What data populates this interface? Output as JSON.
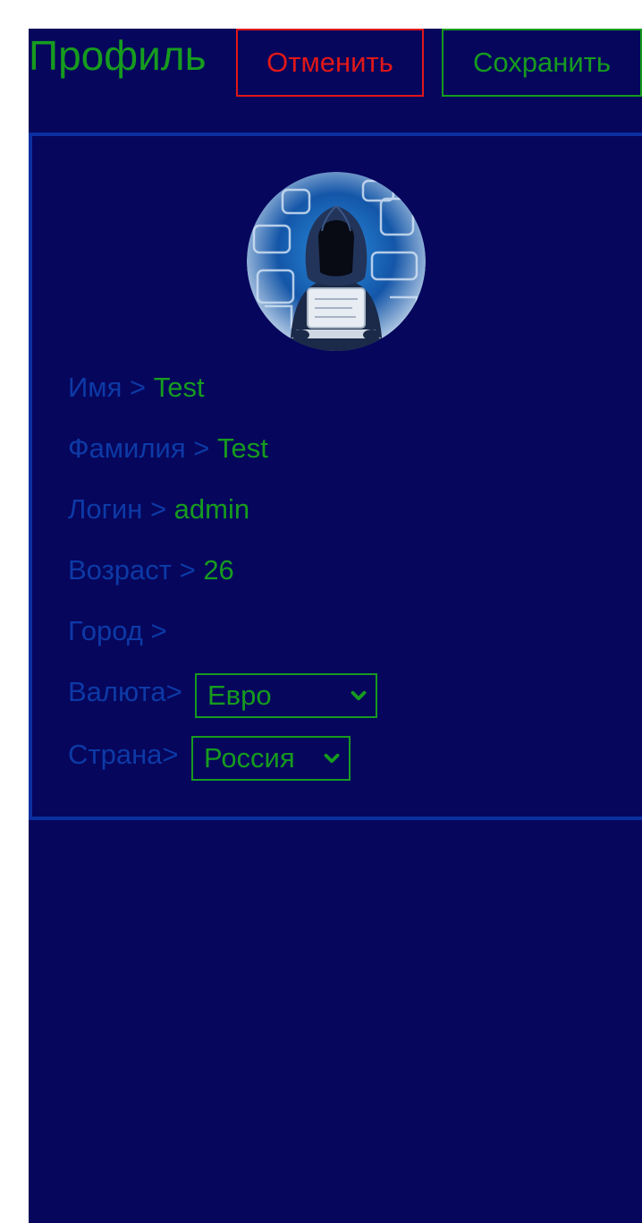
{
  "header": {
    "title": "Профиль",
    "cancel_label": "Отменить",
    "save_label": "Сохранить"
  },
  "profile": {
    "avatar_icon": "hooded-hacker-avatar",
    "fields": [
      {
        "label": "Имя >",
        "value": "Test"
      },
      {
        "label": "Фамилия >",
        "value": "Test"
      },
      {
        "label": "Логин >",
        "value": "admin"
      },
      {
        "label": "Возраст >",
        "value": "26"
      },
      {
        "label": "Город >",
        "value": ""
      }
    ],
    "currency": {
      "label": "Валюта>",
      "selected": "Евро"
    },
    "country": {
      "label": "Страна>",
      "selected": "Россия"
    }
  },
  "colors": {
    "background": "#06065c",
    "accent_green": "#169b1f",
    "label_blue": "#0d3aa6",
    "cancel_red": "#e01818",
    "card_border": "#0b2fa0"
  }
}
